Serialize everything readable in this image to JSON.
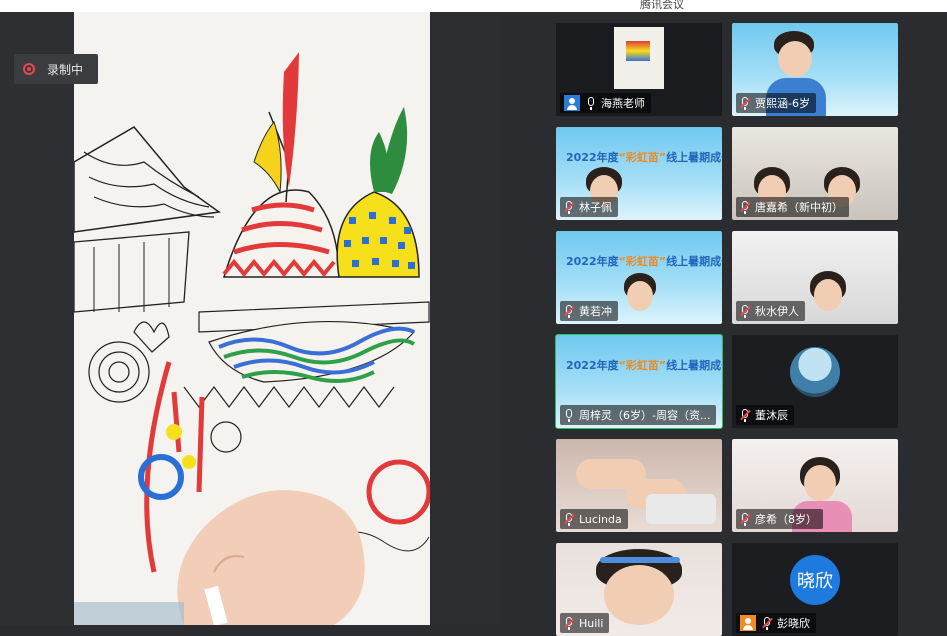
{
  "window": {
    "title": "腾讯会议"
  },
  "recording": {
    "label": "录制中"
  },
  "banner": {
    "line1_prefix": "2022年度",
    "line1_highlight": "“彩虹苗”",
    "line1_suffix": "线上暑期成长营"
  },
  "participants": [
    {
      "name": "海燕老师",
      "role": "host",
      "mic": "on",
      "video": "share-thumb"
    },
    {
      "name": "贾熙涵-6岁",
      "role": "attendee",
      "mic": "muted",
      "video": "camera"
    },
    {
      "name": "林子佩",
      "role": "attendee",
      "mic": "muted",
      "video": "banner"
    },
    {
      "name": "唐嘉希（新中初）",
      "role": "attendee",
      "mic": "muted",
      "video": "camera"
    },
    {
      "name": "黄若冲",
      "role": "attendee",
      "mic": "muted",
      "video": "banner"
    },
    {
      "name": "秋水伊人",
      "role": "attendee",
      "mic": "muted",
      "video": "camera"
    },
    {
      "name": "周梓灵（6岁）-周容（资...",
      "role": "attendee",
      "mic": "on",
      "video": "banner",
      "active": true
    },
    {
      "name": "董沐辰",
      "role": "attendee",
      "mic": "muted",
      "video": "avatar-photo"
    },
    {
      "name": "Lucinda",
      "role": "attendee",
      "mic": "muted",
      "video": "camera"
    },
    {
      "name": "彦希（8岁）",
      "role": "attendee",
      "mic": "muted",
      "video": "camera"
    },
    {
      "name": "Huili",
      "role": "attendee",
      "mic": "muted",
      "video": "camera"
    },
    {
      "name": "彭晓欣",
      "role": "host",
      "mic": "muted",
      "video": "avatar-initial",
      "avatar_text": "晓欣"
    }
  ],
  "colors": {
    "active_speaker": "#2fbe5b",
    "recording": "#e5484d",
    "host_icon": "#2b7bd8"
  }
}
